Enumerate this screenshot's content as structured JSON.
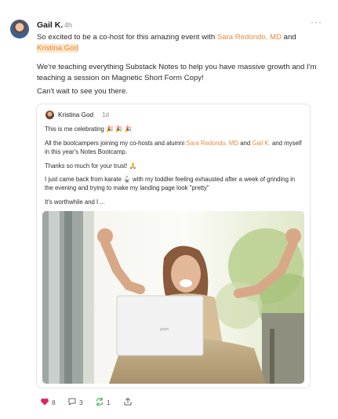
{
  "post": {
    "author": "Gail K.",
    "time": "4h",
    "more_label": "···",
    "p1_a": "So excited to be a co-host for this amazing event with ",
    "p1_mention1": "Sara Redondo, MD",
    "p1_b": " and ",
    "p1_mention2": "Kristina God",
    "p2": "We're teaching everything Substack Notes to help you have massive growth and I'm teaching a session on Magnetic Short Form Copy!",
    "p3": "Can't wait to see you there."
  },
  "quote": {
    "author": "Kristina God",
    "time": "1d",
    "l1": "This is me celebrating 🎉 🎉 🎉",
    "l2_a": "All the bootcampers joining my co-hosts and alumni ",
    "l2_mention1": "Sara Redondo, MD",
    "l2_b": " and ",
    "l2_mention2": "Gail K.",
    "l2_c": " and myself in this year's Notes Bootcamp.",
    "l3": "Thanks so much for your trust! 🙏",
    "l4": "I just came back from karate 🥋 with my toddler feeling exhausted after a week of grinding in the evening and trying to make my landing page look \"pretty\"",
    "l5": "It's worthwhile and I ...",
    "laptop_brand": "gram"
  },
  "actions": {
    "likes": "8",
    "comments": "3",
    "restacks": "1"
  },
  "colors": {
    "mention": "#e68a3a",
    "mention_highlight": "#fde7cc",
    "like": "#e0245e",
    "restack": "#2fa84f"
  },
  "icons": [
    "heart-icon",
    "comment-icon",
    "restack-icon",
    "share-icon",
    "more-icon"
  ]
}
